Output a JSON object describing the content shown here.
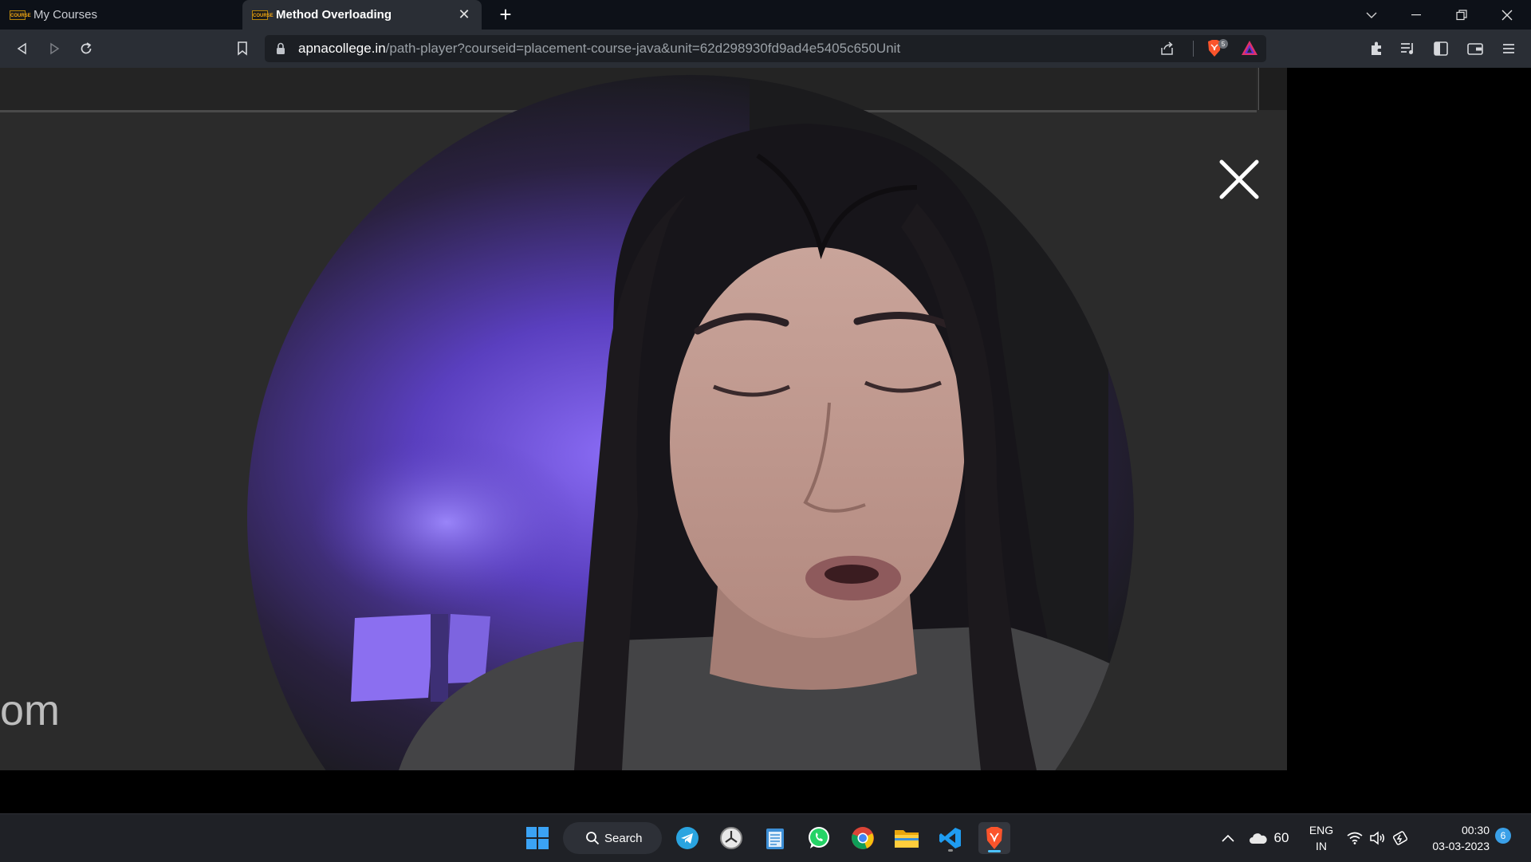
{
  "browser": {
    "tabs": [
      {
        "title": "My Courses",
        "favicon": "COURSE"
      },
      {
        "title": "Method Overloading",
        "favicon": "COURSE",
        "active": true
      }
    ],
    "url_host": "apnacollege.in",
    "url_path": "/path-player?courseid=placement-course-java&unit=62d298930fd9ad4e5405c650Unit",
    "shield_count": "5"
  },
  "video": {
    "watermark_text": "om"
  },
  "taskbar": {
    "search_label": "Search",
    "weather_temp": "60",
    "language_line1": "ENG",
    "language_line2": "IN",
    "time": "00:30",
    "date": "03-03-2023",
    "notification_count": "6"
  },
  "colors": {
    "accent": "#4cc2ff",
    "brave_orange": "#fb542b",
    "background_purple": "#6a4ad6"
  }
}
